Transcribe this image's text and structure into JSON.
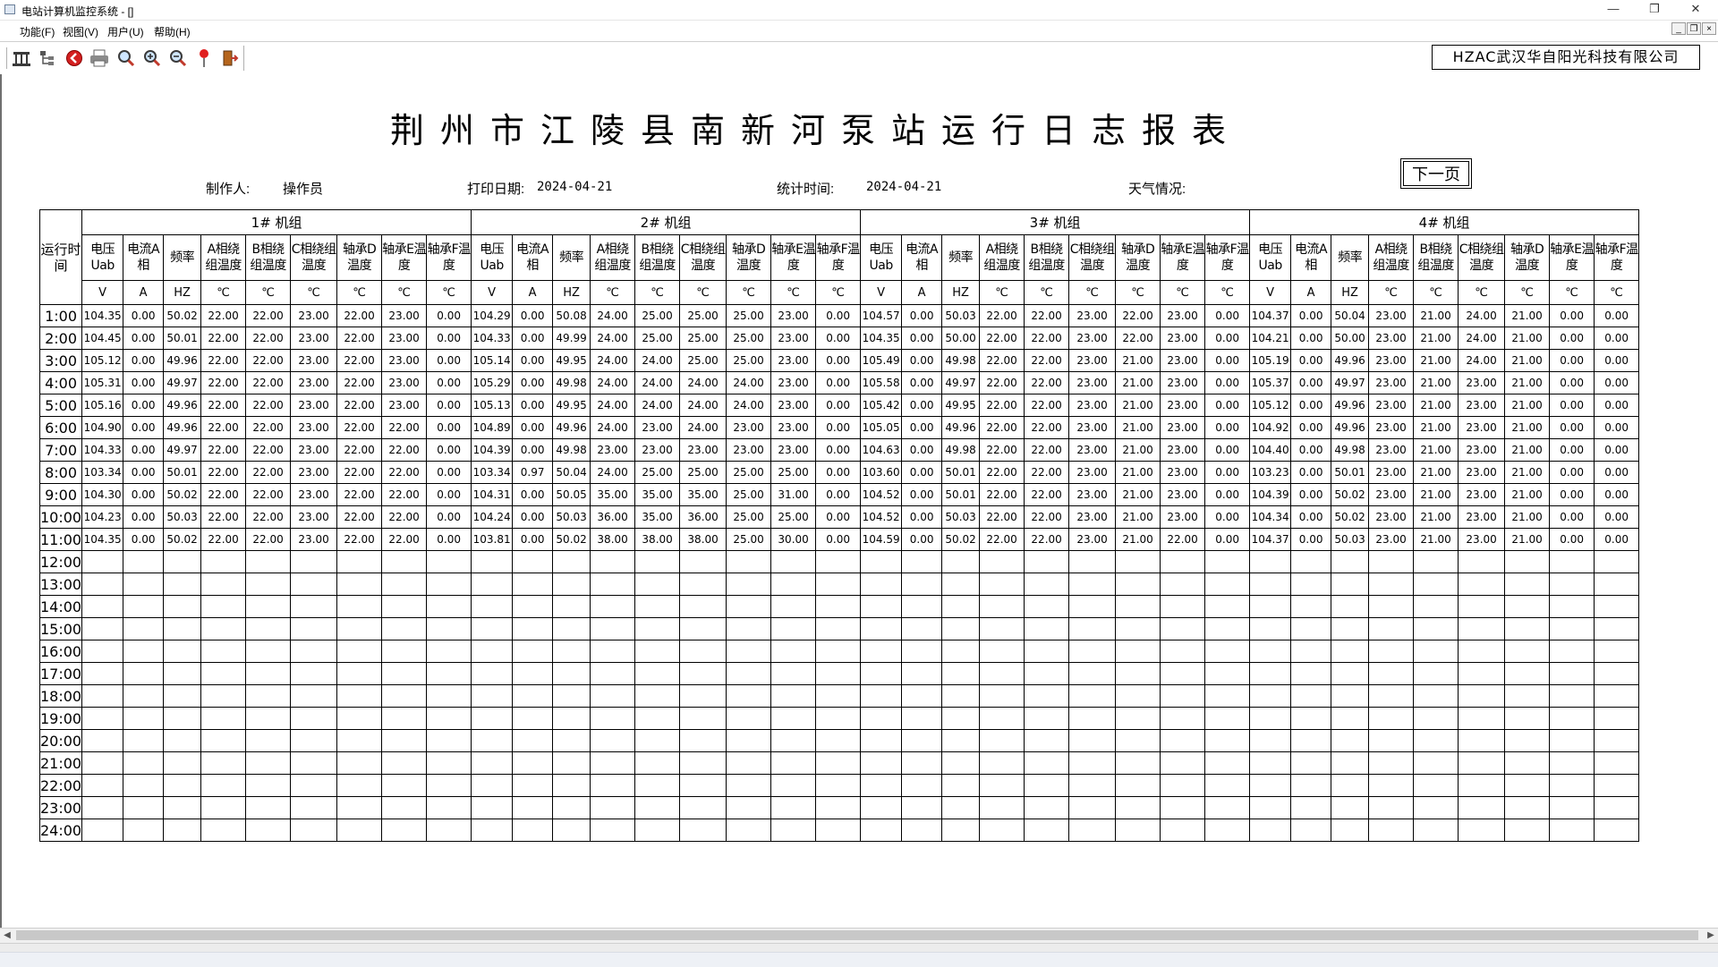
{
  "window": {
    "title": "电站计算机监控系统 - []"
  },
  "menu": [
    "功能(F)",
    "视图(V)",
    "用户(U)",
    "帮助(H)"
  ],
  "toolbar_icons": [
    "station-icon",
    "tree-icon",
    "stop-icon",
    "print-icon",
    "zoom-icon",
    "zoom-in-icon",
    "zoom-out-icon",
    "pin-icon",
    "exit-icon"
  ],
  "company": "HZAC武汉华自阳光科技有限公司",
  "report": {
    "title": "荆州市江陵县南新河泵站运行日志报表",
    "next_page": "下一页",
    "maker_label": "制作人:",
    "maker": "操作员",
    "print_date_label": "打印日期:",
    "print_date": "2024-04-21",
    "stat_time_label": "统计时间:",
    "stat_time": "2024-04-21",
    "weather_label": "天气情况:",
    "weather": ""
  },
  "table": {
    "run_time_header": "运行时间",
    "groups": [
      "1# 机组",
      "2# 机组",
      "3# 机组",
      "4# 机组"
    ],
    "columns": [
      "电压Uab",
      "电流A相",
      "频率",
      "A相绕组温度",
      "B相绕组温度",
      "C相绕组温度",
      "轴承D温度",
      "轴承E温度",
      "轴承F温度"
    ],
    "units": [
      "V",
      "A",
      "HZ",
      "℃",
      "℃",
      "℃",
      "℃",
      "℃",
      "℃"
    ],
    "times": [
      "1:00",
      "2:00",
      "3:00",
      "4:00",
      "5:00",
      "6:00",
      "7:00",
      "8:00",
      "9:00",
      "10:00",
      "11:00",
      "12:00",
      "13:00",
      "14:00",
      "15:00",
      "16:00",
      "17:00",
      "18:00",
      "19:00",
      "20:00",
      "21:00",
      "22:00",
      "23:00",
      "24:00"
    ],
    "rows": [
      [
        "104.35",
        "0.00",
        "50.02",
        "22.00",
        "22.00",
        "23.00",
        "22.00",
        "23.00",
        "0.00",
        "104.29",
        "0.00",
        "50.08",
        "24.00",
        "25.00",
        "25.00",
        "25.00",
        "23.00",
        "0.00",
        "104.57",
        "0.00",
        "50.03",
        "22.00",
        "22.00",
        "23.00",
        "22.00",
        "23.00",
        "0.00",
        "104.37",
        "0.00",
        "50.04",
        "23.00",
        "21.00",
        "24.00",
        "21.00",
        "0.00",
        "0.00"
      ],
      [
        "104.45",
        "0.00",
        "50.01",
        "22.00",
        "22.00",
        "23.00",
        "22.00",
        "23.00",
        "0.00",
        "104.33",
        "0.00",
        "49.99",
        "24.00",
        "25.00",
        "25.00",
        "25.00",
        "23.00",
        "0.00",
        "104.35",
        "0.00",
        "50.00",
        "22.00",
        "22.00",
        "23.00",
        "22.00",
        "23.00",
        "0.00",
        "104.21",
        "0.00",
        "50.00",
        "23.00",
        "21.00",
        "24.00",
        "21.00",
        "0.00",
        "0.00"
      ],
      [
        "105.12",
        "0.00",
        "49.96",
        "22.00",
        "22.00",
        "23.00",
        "22.00",
        "23.00",
        "0.00",
        "105.14",
        "0.00",
        "49.95",
        "24.00",
        "24.00",
        "25.00",
        "25.00",
        "23.00",
        "0.00",
        "105.49",
        "0.00",
        "49.98",
        "22.00",
        "22.00",
        "23.00",
        "21.00",
        "23.00",
        "0.00",
        "105.19",
        "0.00",
        "49.96",
        "23.00",
        "21.00",
        "24.00",
        "21.00",
        "0.00",
        "0.00"
      ],
      [
        "105.31",
        "0.00",
        "49.97",
        "22.00",
        "22.00",
        "23.00",
        "22.00",
        "23.00",
        "0.00",
        "105.29",
        "0.00",
        "49.98",
        "24.00",
        "24.00",
        "24.00",
        "24.00",
        "23.00",
        "0.00",
        "105.58",
        "0.00",
        "49.97",
        "22.00",
        "22.00",
        "23.00",
        "21.00",
        "23.00",
        "0.00",
        "105.37",
        "0.00",
        "49.97",
        "23.00",
        "21.00",
        "23.00",
        "21.00",
        "0.00",
        "0.00"
      ],
      [
        "105.16",
        "0.00",
        "49.96",
        "22.00",
        "22.00",
        "23.00",
        "22.00",
        "23.00",
        "0.00",
        "105.13",
        "0.00",
        "49.95",
        "24.00",
        "24.00",
        "24.00",
        "24.00",
        "23.00",
        "0.00",
        "105.42",
        "0.00",
        "49.95",
        "22.00",
        "22.00",
        "23.00",
        "21.00",
        "23.00",
        "0.00",
        "105.12",
        "0.00",
        "49.96",
        "23.00",
        "21.00",
        "23.00",
        "21.00",
        "0.00",
        "0.00"
      ],
      [
        "104.90",
        "0.00",
        "49.96",
        "22.00",
        "22.00",
        "23.00",
        "22.00",
        "22.00",
        "0.00",
        "104.89",
        "0.00",
        "49.96",
        "24.00",
        "23.00",
        "24.00",
        "23.00",
        "23.00",
        "0.00",
        "105.05",
        "0.00",
        "49.96",
        "22.00",
        "22.00",
        "23.00",
        "21.00",
        "23.00",
        "0.00",
        "104.92",
        "0.00",
        "49.96",
        "23.00",
        "21.00",
        "23.00",
        "21.00",
        "0.00",
        "0.00"
      ],
      [
        "104.33",
        "0.00",
        "49.97",
        "22.00",
        "22.00",
        "23.00",
        "22.00",
        "22.00",
        "0.00",
        "104.39",
        "0.00",
        "49.98",
        "23.00",
        "23.00",
        "23.00",
        "23.00",
        "23.00",
        "0.00",
        "104.63",
        "0.00",
        "49.98",
        "22.00",
        "22.00",
        "23.00",
        "21.00",
        "23.00",
        "0.00",
        "104.40",
        "0.00",
        "49.98",
        "23.00",
        "21.00",
        "23.00",
        "21.00",
        "0.00",
        "0.00"
      ],
      [
        "103.34",
        "0.00",
        "50.01",
        "22.00",
        "22.00",
        "23.00",
        "22.00",
        "22.00",
        "0.00",
        "103.34",
        "0.97",
        "50.04",
        "24.00",
        "25.00",
        "25.00",
        "25.00",
        "25.00",
        "0.00",
        "103.60",
        "0.00",
        "50.01",
        "22.00",
        "22.00",
        "23.00",
        "21.00",
        "23.00",
        "0.00",
        "103.23",
        "0.00",
        "50.01",
        "23.00",
        "21.00",
        "23.00",
        "21.00",
        "0.00",
        "0.00"
      ],
      [
        "104.30",
        "0.00",
        "50.02",
        "22.00",
        "22.00",
        "23.00",
        "22.00",
        "22.00",
        "0.00",
        "104.31",
        "0.00",
        "50.05",
        "35.00",
        "35.00",
        "35.00",
        "25.00",
        "31.00",
        "0.00",
        "104.52",
        "0.00",
        "50.01",
        "22.00",
        "22.00",
        "23.00",
        "21.00",
        "23.00",
        "0.00",
        "104.39",
        "0.00",
        "50.02",
        "23.00",
        "21.00",
        "23.00",
        "21.00",
        "0.00",
        "0.00"
      ],
      [
        "104.23",
        "0.00",
        "50.03",
        "22.00",
        "22.00",
        "23.00",
        "22.00",
        "22.00",
        "0.00",
        "104.24",
        "0.00",
        "50.03",
        "36.00",
        "35.00",
        "36.00",
        "25.00",
        "25.00",
        "0.00",
        "104.52",
        "0.00",
        "50.03",
        "22.00",
        "22.00",
        "23.00",
        "21.00",
        "23.00",
        "0.00",
        "104.34",
        "0.00",
        "50.02",
        "23.00",
        "21.00",
        "23.00",
        "21.00",
        "0.00",
        "0.00"
      ],
      [
        "104.35",
        "0.00",
        "50.02",
        "22.00",
        "22.00",
        "23.00",
        "22.00",
        "22.00",
        "0.00",
        "103.81",
        "0.00",
        "50.02",
        "38.00",
        "38.00",
        "38.00",
        "25.00",
        "30.00",
        "0.00",
        "104.59",
        "0.00",
        "50.02",
        "22.00",
        "22.00",
        "23.00",
        "21.00",
        "22.00",
        "0.00",
        "104.37",
        "0.00",
        "50.03",
        "23.00",
        "21.00",
        "23.00",
        "21.00",
        "0.00",
        "0.00"
      ]
    ]
  }
}
